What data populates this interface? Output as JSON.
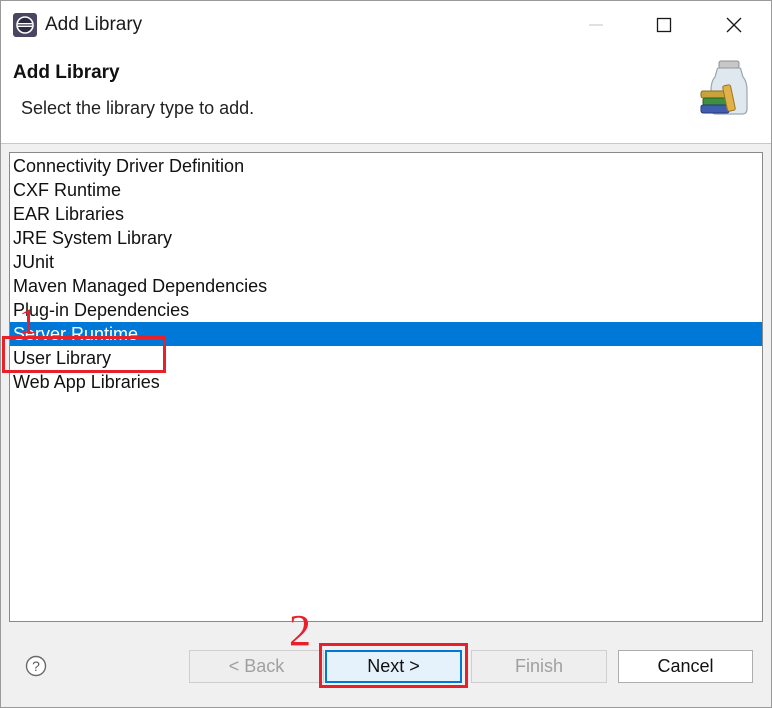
{
  "window": {
    "title": "Add Library"
  },
  "banner": {
    "title": "Add Library",
    "description": "Select the library type to add."
  },
  "library_types": [
    {
      "label": "Connectivity Driver Definition",
      "selected": false
    },
    {
      "label": "CXF Runtime",
      "selected": false
    },
    {
      "label": "EAR Libraries",
      "selected": false
    },
    {
      "label": "JRE System Library",
      "selected": false
    },
    {
      "label": "JUnit",
      "selected": false
    },
    {
      "label": "Maven Managed Dependencies",
      "selected": false
    },
    {
      "label": "Plug-in Dependencies",
      "selected": false
    },
    {
      "label": "Server Runtime",
      "selected": true
    },
    {
      "label": "User Library",
      "selected": false
    },
    {
      "label": "Web App Libraries",
      "selected": false
    }
  ],
  "buttons": {
    "back": "< Back",
    "next": "Next >",
    "finish": "Finish",
    "cancel": "Cancel",
    "help": "?"
  },
  "annotations": {
    "step1": "1",
    "step2": "2"
  },
  "colors": {
    "selection": "#0078d7",
    "annotation": "#e8202a"
  }
}
